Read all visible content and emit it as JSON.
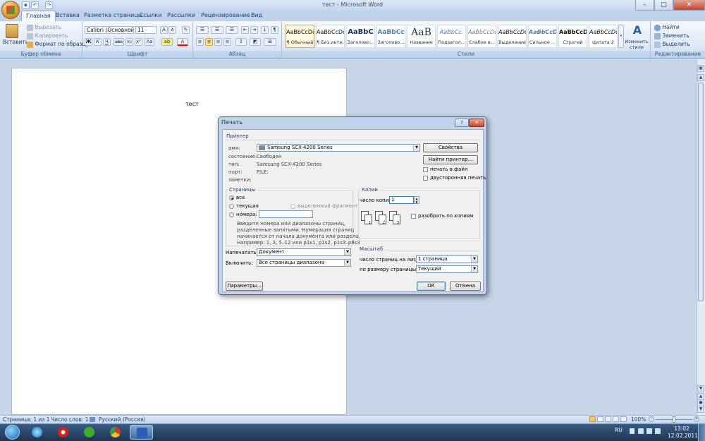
{
  "window": {
    "title": "тест - Microsoft Word",
    "min": "–",
    "max": "□",
    "close": "✕"
  },
  "tabs": [
    "Главная",
    "Вставка",
    "Разметка страницы",
    "Ссылки",
    "Рассылки",
    "Рецензирование",
    "Вид"
  ],
  "clipboard": {
    "paste": "Вставить",
    "cut": "Вырезать",
    "copy": "Копировать",
    "format_painter": "Формат по образцу",
    "label": "Буфер обмена"
  },
  "font": {
    "name": "Calibri (Основной те",
    "size": "11",
    "label": "Шрифт",
    "bold": "Ж",
    "italic": "К",
    "underline": "Ч",
    "strike": "abc",
    "sub": "x₂",
    "sup": "x²",
    "case": "Aa",
    "grow": "A",
    "shrink": "A"
  },
  "paragraph": {
    "label": "Абзац",
    "pilcrow": "¶"
  },
  "styles": {
    "label": "Стили",
    "change": "Изменить стили",
    "items": [
      {
        "sample": "AaBbCcDc",
        "name": "¶ Обычный"
      },
      {
        "sample": "AaBbCcDc",
        "name": "¶ Без инте..."
      },
      {
        "sample": "AaBbC",
        "name": "Заголово..."
      },
      {
        "sample": "AaBbCc",
        "name": "Заголово..."
      },
      {
        "sample": "AaB",
        "name": "Название"
      },
      {
        "sample": "AaBbCc.",
        "name": "Подзагол..."
      },
      {
        "sample": "AaBbCcDc",
        "name": "Слабое в..."
      },
      {
        "sample": "AaBbCcDc",
        "name": "Выделение"
      },
      {
        "sample": "AaBbCcDc",
        "name": "Сильное ..."
      },
      {
        "sample": "AaBbCcDc",
        "name": "Строгий"
      },
      {
        "sample": "AaBbCcDc",
        "name": "Цитата 2"
      }
    ]
  },
  "editing": {
    "find": "Найти",
    "replace": "Заменить",
    "select": "Выделить",
    "label": "Редактирование"
  },
  "document": {
    "text": "тест"
  },
  "status": {
    "page": "Страница: 1 из 1",
    "words": "Число слов: 1",
    "lang": "Русский (Россия)",
    "zoom": "100%"
  },
  "taskbar": {
    "lang": "RU",
    "time": "13:02",
    "date": "12.02.2011"
  },
  "dialog": {
    "title": "Печать",
    "help": "?",
    "close": "✕",
    "printer": {
      "section": "Принтер",
      "name_label": "имя:",
      "name_value": "Samsung SCX-4200 Series",
      "status_label": "состояние:",
      "status_value": "Свободен",
      "type_label": "тип:",
      "type_value": "Samsung SCX-4200 Series",
      "port_label": "порт:",
      "port_value": "FILE:",
      "notes_label": "заметки:",
      "properties": "Свойства",
      "find_printer": "Найти принтер...",
      "print_to_file": "печать в файл",
      "duplex": "двусторонняя печать"
    },
    "pages": {
      "section": "Страницы",
      "all": "все",
      "current": "текущая",
      "selection": "выделенный фрагмент",
      "numbers": "номера:",
      "hint1": "Введите номера или диапазоны страниц,",
      "hint2": "разделенные запятыми. Нумерация страниц",
      "hint3": "начинается от начала документа или раздела.",
      "hint4": "Например: 1, 3, 5–12 или p1s1, p1s2, p1s3–p8s3"
    },
    "copies": {
      "section": "Копии",
      "count_label": "число копий:",
      "count_value": "1",
      "collate": "разобрать по копиям",
      "c1": "1",
      "c2": "2",
      "c3": "3"
    },
    "print_what": {
      "label": "Напечатать:",
      "value": "Документ"
    },
    "include": {
      "label": "Включить:",
      "value": "Все страницы диапазона"
    },
    "zoom": {
      "section": "Масштаб",
      "pps_label": "число страниц на листе:",
      "pps_value": "1 страница",
      "scale_label": "по размеру страницы:",
      "scale_value": "Текущий"
    },
    "options": "Параметры...",
    "ok": "ОК",
    "cancel": "Отмена"
  }
}
